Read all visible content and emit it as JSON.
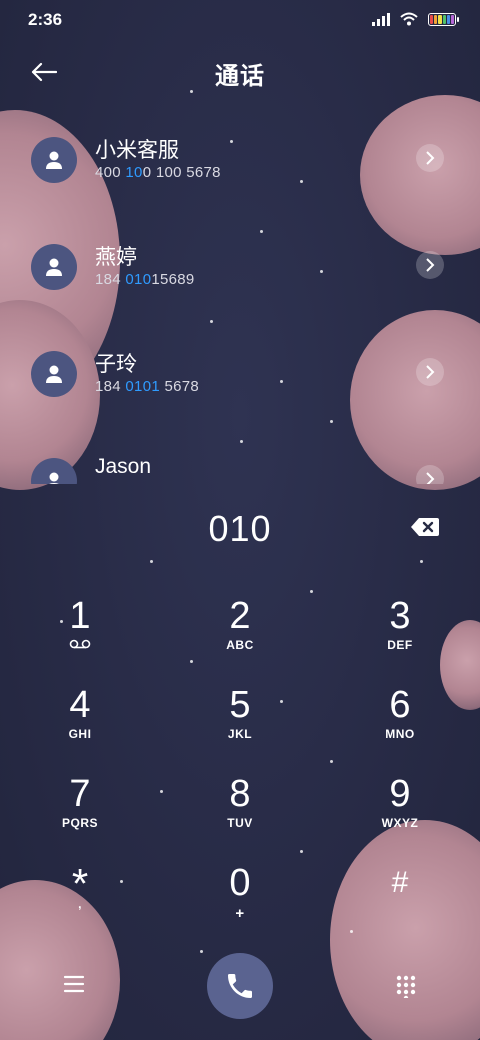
{
  "status_bar": {
    "time": "2:36",
    "icons": [
      "signal-icon",
      "wifi-icon",
      "battery-icon"
    ],
    "battery_colors": [
      "#e84b4b",
      "#f3a33a",
      "#f0e04a",
      "#53c26a",
      "#4a8fe6",
      "#b667d6"
    ]
  },
  "header": {
    "title": "通话",
    "back_icon": "back-arrow-icon"
  },
  "results": [
    {
      "name": "小米客服",
      "number_parts": [
        "400",
        " 10",
        "0 100",
        " 5678"
      ]
    },
    {
      "name": "燕婷",
      "number_parts": [
        "184 ",
        "010",
        "",
        "15689"
      ]
    },
    {
      "name": "子玲",
      "number_parts": [
        "184 ",
        "0101",
        "",
        " 5678"
      ]
    },
    {
      "name": "Jason",
      "number_parts": [
        "",
        "",
        "",
        ""
      ]
    }
  ],
  "dialer": {
    "input": "010",
    "keys": [
      {
        "digit": "1",
        "letters": ""
      },
      {
        "digit": "2",
        "letters": "ABC"
      },
      {
        "digit": "3",
        "letters": "DEF"
      },
      {
        "digit": "4",
        "letters": "GHI"
      },
      {
        "digit": "5",
        "letters": "JKL"
      },
      {
        "digit": "6",
        "letters": "MNO"
      },
      {
        "digit": "7",
        "letters": "PQRS"
      },
      {
        "digit": "8",
        "letters": "TUV"
      },
      {
        "digit": "9",
        "letters": "WXYZ"
      },
      {
        "digit": "*",
        "letters": ","
      },
      {
        "digit": "0",
        "letters": "+"
      },
      {
        "digit": "#",
        "letters": ""
      }
    ]
  },
  "colors": {
    "highlight": "#2f9bff",
    "avatar": "#4c5580",
    "call_button": "#5a6390"
  }
}
